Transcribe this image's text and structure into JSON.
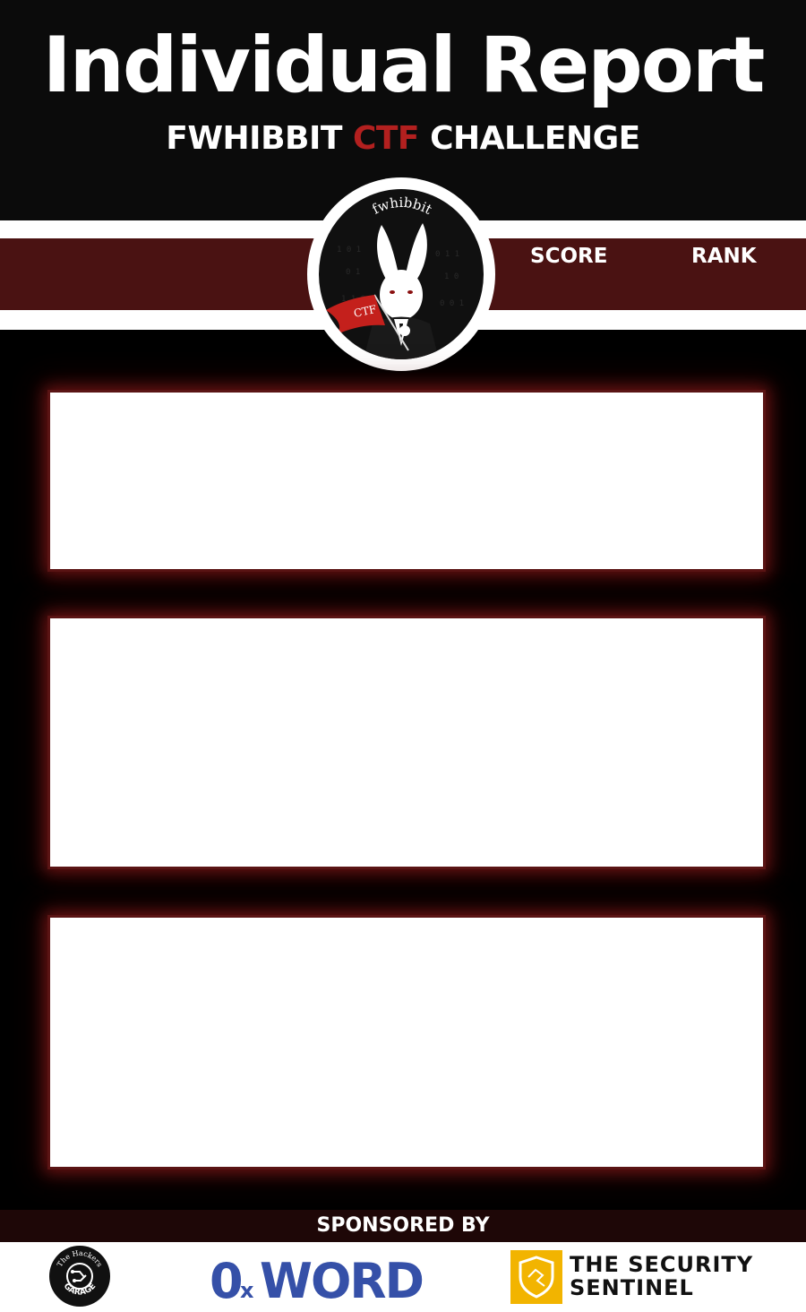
{
  "header": {
    "title": "Individual Report",
    "subtitle_part1": "FWHIBBIT",
    "subtitle_accent": "CTF",
    "subtitle_part2": "CHALLENGE"
  },
  "band": {
    "score_label": "SCORE",
    "rank_label": "RANK"
  },
  "logo": {
    "arc_text": "fwhibbit",
    "flag_text": "CTF"
  },
  "footer": {
    "sponsored_label": "SPONSORED BY",
    "sponsor_1_text": "The Hackers GARAGE",
    "sponsor_2_text": "0xWORD",
    "sponsor_3_line1": "THE SECURITY",
    "sponsor_3_line2": "SENTINEL"
  },
  "colors": {
    "accent": "#b3201f",
    "band": "#4a1212",
    "card_border": "#5a1414",
    "oxword_blue": "#3550a8",
    "sentinel_gold": "#f2b400"
  }
}
